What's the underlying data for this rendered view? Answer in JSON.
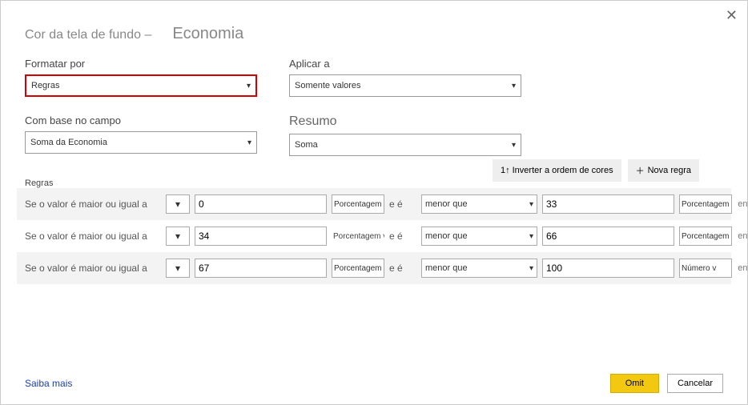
{
  "header": {
    "title": "Cor da tela de fundo –",
    "subject": "Economia"
  },
  "formatBy": {
    "label": "Formatar por",
    "value": "Regras"
  },
  "applyTo": {
    "label": "Aplicar a",
    "value": "Somente valores"
  },
  "basedOn": {
    "label": "Com base no campo",
    "value": "Soma da Economia"
  },
  "summary": {
    "label": "Resumo",
    "value": "Soma"
  },
  "rulesLabel": "Regras",
  "buttons": {
    "reverse": "1↑ Inverter a ordem de cores",
    "newRule": "Nova regra"
  },
  "ruleText": {
    "if": "Se o valor",
    "gte": "é maior ou igual a",
    "and": "e é",
    "lt": "menor que",
    "then": "então"
  },
  "rules": [
    {
      "min": "0",
      "minUnit": "Porcentagem",
      "max": "33",
      "maxUnit": "Porcentagem v",
      "color": "#2ecc40",
      "unitBoxed": true
    },
    {
      "min": "34",
      "minUnit": "Porcentagem v|",
      "max": "66",
      "maxUnit": "Porcentagem v",
      "color": "#ffe600",
      "unitBoxed": false
    },
    {
      "min": "67",
      "minUnit": "Porcentagem",
      "max": "100",
      "maxUnit": "Número v",
      "color": "#e60000",
      "unitBoxed": true
    }
  ],
  "footer": {
    "learnMore": "Saiba mais",
    "ok": "Omit",
    "cancel": "Cancelar"
  }
}
